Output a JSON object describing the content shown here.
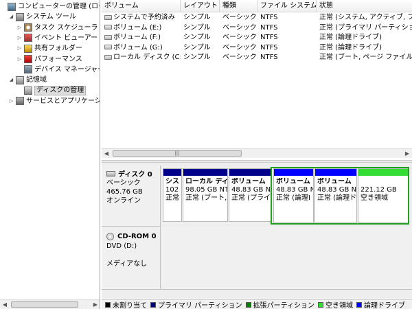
{
  "tree": {
    "items": [
      {
        "label": "コンピューターの管理 (ローカル)",
        "icon": "computer-management-icon",
        "indent": 0,
        "expander": ""
      },
      {
        "label": "システム ツール",
        "icon": "system-tools-icon",
        "indent": 1,
        "expander": "◢"
      },
      {
        "label": "タスク スケジューラ",
        "icon": "task-scheduler-icon",
        "indent": 2,
        "expander": "▷"
      },
      {
        "label": "イベント ビューアー",
        "icon": "event-viewer-icon",
        "indent": 2,
        "expander": "▷"
      },
      {
        "label": "共有フォルダー",
        "icon": "shared-folders-icon",
        "indent": 2,
        "expander": "▷"
      },
      {
        "label": "パフォーマンス",
        "icon": "performance-icon",
        "indent": 2,
        "expander": "▷"
      },
      {
        "label": "デバイス マネージャー",
        "icon": "device-manager-icon",
        "indent": 2,
        "expander": ""
      },
      {
        "label": "記憶域",
        "icon": "storage-icon",
        "indent": 1,
        "expander": "◢"
      },
      {
        "label": "ディスクの管理",
        "icon": "disk-management-icon",
        "indent": 2,
        "expander": "",
        "selected": true
      },
      {
        "label": "サービスとアプリケーション",
        "icon": "services-apps-icon",
        "indent": 1,
        "expander": "▷"
      }
    ]
  },
  "volume_table": {
    "columns": [
      "ボリューム",
      "レイアウト",
      "種類",
      "ファイル システム",
      "状態"
    ],
    "rows": [
      {
        "volume": "システムで予約済み",
        "layout": "シンプル",
        "type": "ベーシック",
        "fs": "NTFS",
        "status": "正常 (システム, アクティブ, プライマリ パーティション)"
      },
      {
        "volume": "ボリューム (E:)",
        "layout": "シンプル",
        "type": "ベーシック",
        "fs": "NTFS",
        "status": "正常 (プライマリ パーティション)"
      },
      {
        "volume": "ボリューム (F:)",
        "layout": "シンプル",
        "type": "ベーシック",
        "fs": "NTFS",
        "status": "正常 (論理ドライブ)"
      },
      {
        "volume": "ボリューム (G:)",
        "layout": "シンプル",
        "type": "ベーシック",
        "fs": "NTFS",
        "status": "正常 (論理ドライブ)"
      },
      {
        "volume": "ローカル ディスク (C:)",
        "layout": "シンプル",
        "type": "ベーシック",
        "fs": "NTFS",
        "status": "正常 (ブート, ページ ファイル, クラッシュ ダンプ)"
      }
    ]
  },
  "disks": {
    "disk0": {
      "title": "ディスク 0",
      "type": "ベーシック",
      "size": "465.76 GB",
      "status": "オンライン",
      "partitions": [
        {
          "name": "シス",
          "size": "102",
          "status": "正常",
          "bar_color": "#00008b"
        },
        {
          "name": "ローカル ディ",
          "size": "98.05 GB NT",
          "status": "正常 (ブート,",
          "bar_color": "#00008b"
        },
        {
          "name": "ボリューム",
          "size": "48.83 GB N",
          "status": "正常 (プライ",
          "bar_color": "#00008b"
        },
        {
          "name": "ボリューム",
          "size": "48.83 GB N",
          "status": "正常 (論理I",
          "bar_color": "#0000ff"
        },
        {
          "name": "ボリューム",
          "size": "48.83 GB N",
          "status": "正常 (論理ド",
          "bar_color": "#0000ff"
        },
        {
          "name": "",
          "size": "221.12 GB",
          "status": "空き領域",
          "bar_color": "#33dd33"
        }
      ]
    },
    "cdrom0": {
      "title": "CD-ROM 0",
      "type": "DVD (D:)",
      "status": "メディアなし"
    }
  },
  "legend": [
    {
      "label": "未割り当て",
      "color": "#000000"
    },
    {
      "label": "プライマリ パーティション",
      "color": "#000080"
    },
    {
      "label": "拡張パーティション",
      "color": "#008000"
    },
    {
      "label": "空き領域",
      "color": "#33dd33"
    },
    {
      "label": "論理ドライブ",
      "color": "#0000ff"
    }
  ],
  "scroll": {
    "grip": "|||"
  }
}
